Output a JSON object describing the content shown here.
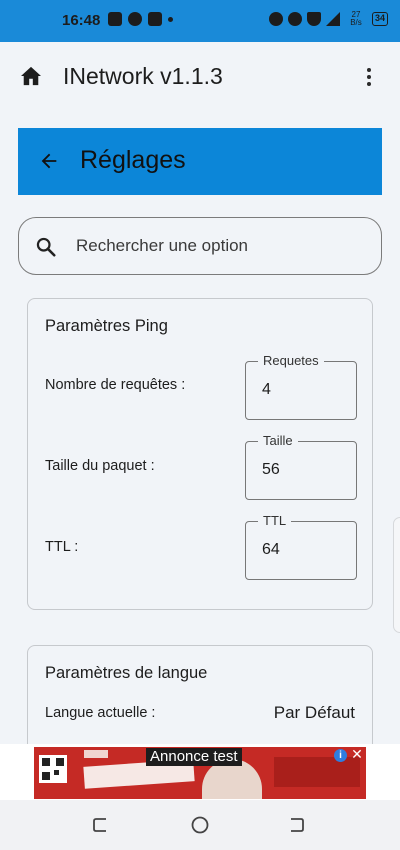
{
  "status_bar": {
    "time": "16:48",
    "network_speed_value": "27",
    "network_speed_unit": "B/s",
    "battery": "34"
  },
  "app_bar": {
    "title": "INetwork v1.1.3",
    "icons": [
      "home-icon",
      "more-vert-icon"
    ]
  },
  "settings_header": {
    "title": "Réglages",
    "back_icon": "arrow-back-icon"
  },
  "search": {
    "placeholder": "Rechercher une option",
    "value": ""
  },
  "ping_settings": {
    "title": "Paramètres Ping",
    "rows": [
      {
        "label": "Nombre de requêtes :",
        "field_label": "Requetes",
        "value": "4"
      },
      {
        "label": "Taille du paquet :",
        "field_label": "Taille",
        "value": "56"
      },
      {
        "label": "TTL :",
        "field_label": "TTL",
        "value": "64"
      }
    ]
  },
  "language_settings": {
    "title": "Paramètres de langue",
    "current_label": "Langue actuelle :",
    "current_value": "Par Défaut"
  },
  "ad": {
    "label": "Annonce test",
    "info_icon": "info-icon",
    "close_icon": "close-icon"
  },
  "nav_bar": {
    "buttons": [
      "recents-button",
      "home-button",
      "back-button"
    ]
  },
  "colors": {
    "status_bar": "#1a8ad8",
    "header_blue": "#0c86d8",
    "background": "#f1f4f8",
    "ad_red": "#c52a25"
  }
}
